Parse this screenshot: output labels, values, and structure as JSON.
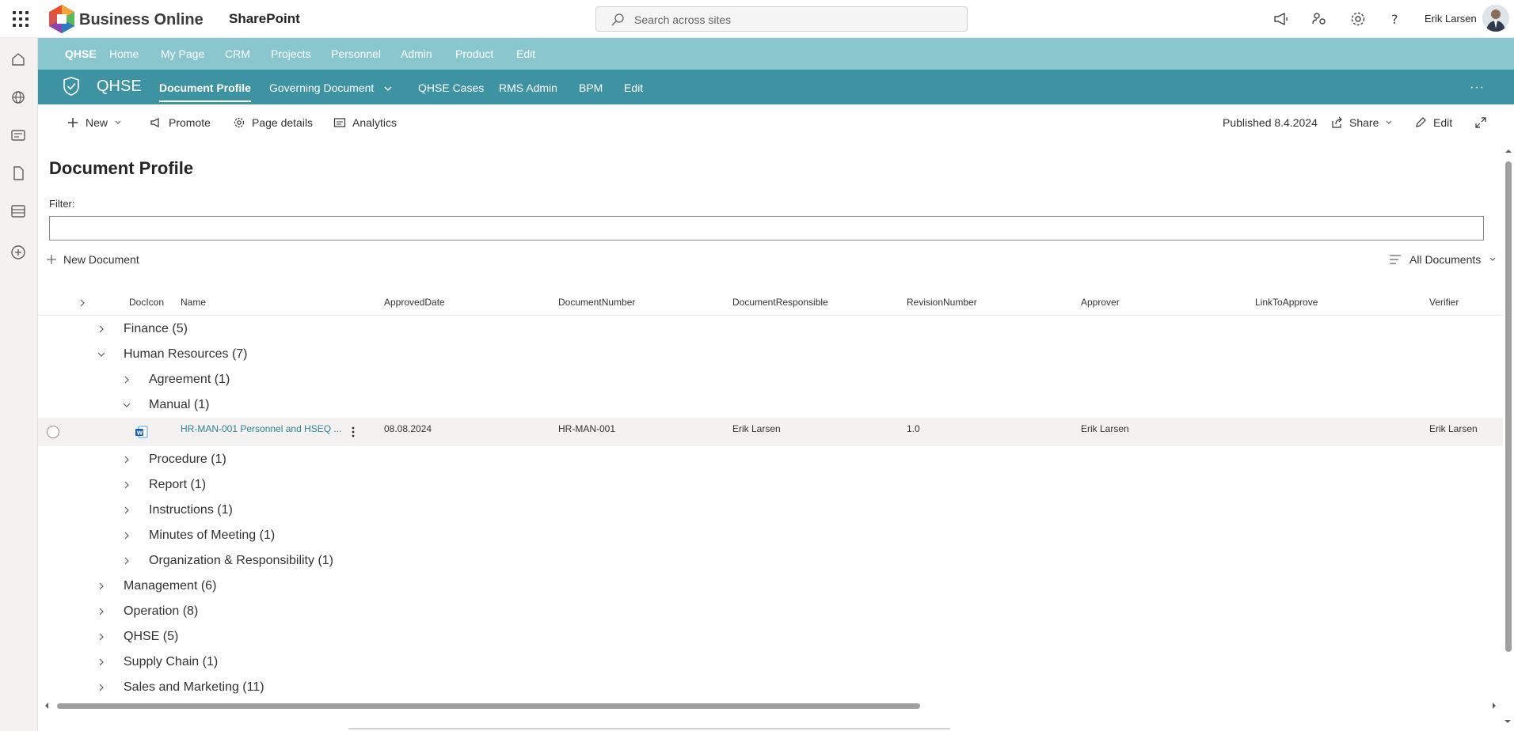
{
  "suite": {
    "brand": "Business Online",
    "app": "SharePoint",
    "search_placeholder": "Search across sites",
    "user": "Erik Larsen"
  },
  "hub_nav": [
    "QHSE",
    "Home",
    "My Page",
    "CRM",
    "Projects",
    "Personnel",
    "Admin",
    "Product",
    "Edit"
  ],
  "site": {
    "title": "QHSE",
    "nav": [
      "Document Profile",
      "Governing Document",
      "QHSE Cases",
      "RMS Admin",
      "BPM",
      "Edit"
    ]
  },
  "command_bar": {
    "new": "New",
    "promote": "Promote",
    "page_details": "Page details",
    "analytics": "Analytics",
    "published": "Published 8.4.2024",
    "share": "Share",
    "edit": "Edit"
  },
  "page": {
    "title": "Document Profile",
    "filter_label": "Filter:",
    "new_document": "New Document",
    "view": "All Documents"
  },
  "columns": [
    "DocIcon",
    "Name",
    "ApprovedDate",
    "DocumentNumber",
    "DocumentResponsible",
    "RevisionNumber",
    "Approver",
    "LinkToApprove",
    "Verifier"
  ],
  "groups": {
    "finance": "Finance (5)",
    "hr": "Human Resources (7)",
    "agreement": "Agreement (1)",
    "manual": "Manual (1)",
    "procedure": "Procedure (1)",
    "report": "Report (1)",
    "instructions": "Instructions (1)",
    "minutes": "Minutes of Meeting (1)",
    "org": "Organization & Responsibility (1)",
    "management": "Management (6)",
    "operation": "Operation (8)",
    "qhse": "QHSE (5)",
    "supply": "Supply Chain (1)",
    "sales": "Sales and Marketing (11)"
  },
  "document": {
    "name": "HR-MAN-001 Personnel and HSEQ ...",
    "approved_date": "08.08.2024",
    "document_number": "HR-MAN-001",
    "responsible": "Erik Larsen",
    "revision": "1.0",
    "approver": "Erik Larsen",
    "verifier": "Erik Larsen"
  },
  "colors": {
    "hub_nav": "#8ac6cd",
    "site_header": "#3e93a3",
    "link": "#2f8095"
  }
}
